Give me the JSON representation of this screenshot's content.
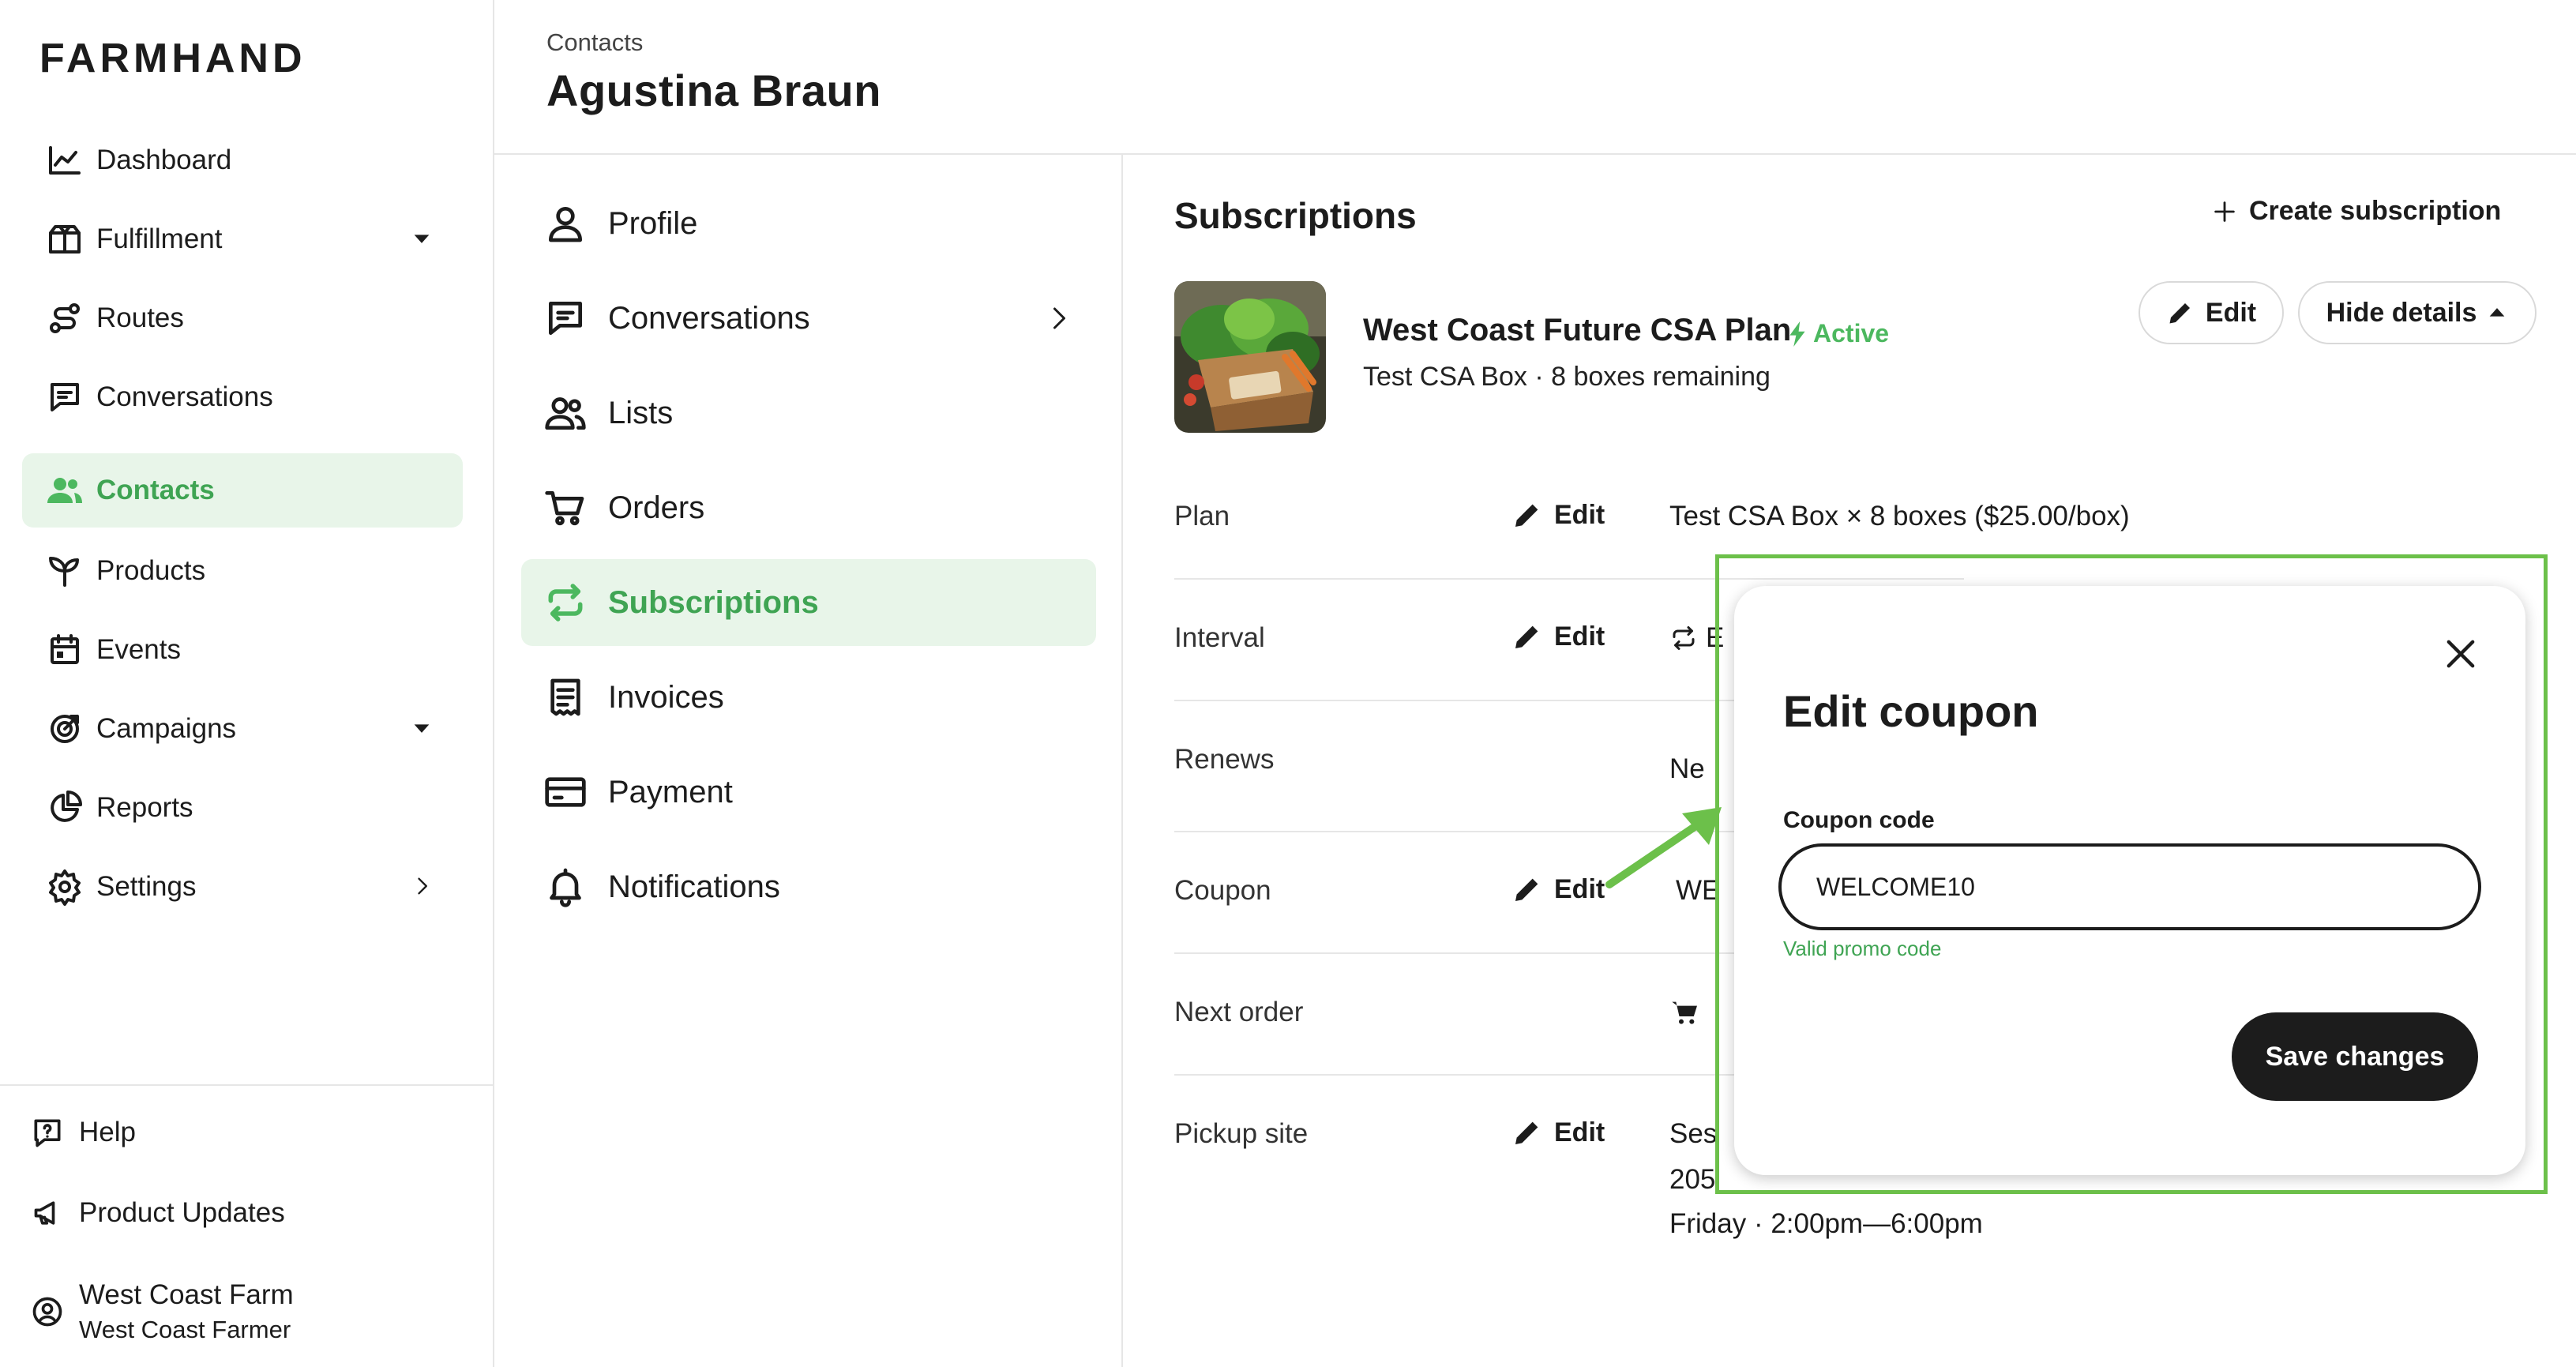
{
  "app": {
    "brand": "FARMHAND"
  },
  "sidebar": {
    "items": [
      {
        "label": "Dashboard",
        "icon": "chart-line-icon"
      },
      {
        "label": "Fulfillment",
        "icon": "box-icon"
      },
      {
        "label": "Routes",
        "icon": "route-icon"
      },
      {
        "label": "Conversations",
        "icon": "chat-icon"
      },
      {
        "label": "Contacts",
        "icon": "users-icon",
        "active": true
      },
      {
        "label": "Products",
        "icon": "sprout-icon"
      },
      {
        "label": "Events",
        "icon": "calendar-icon"
      },
      {
        "label": "Campaigns",
        "icon": "target-icon"
      },
      {
        "label": "Reports",
        "icon": "pie-chart-icon"
      },
      {
        "label": "Settings",
        "icon": "gear-icon"
      }
    ],
    "footer": {
      "help": "Help",
      "product_updates": "Product Updates",
      "account_name": "West Coast Farm",
      "account_role": "West Coast Farmer"
    }
  },
  "header": {
    "breadcrumb": "Contacts",
    "title": "Agustina Braun"
  },
  "subnav": {
    "items": [
      {
        "label": "Profile",
        "icon": "user-icon"
      },
      {
        "label": "Conversations",
        "icon": "chat-icon"
      },
      {
        "label": "Lists",
        "icon": "users-icon"
      },
      {
        "label": "Orders",
        "icon": "cart-icon"
      },
      {
        "label": "Subscriptions",
        "icon": "repeat-icon",
        "active": true
      },
      {
        "label": "Invoices",
        "icon": "receipt-icon"
      },
      {
        "label": "Payment",
        "icon": "credit-card-icon"
      },
      {
        "label": "Notifications",
        "icon": "bell-icon"
      }
    ]
  },
  "subscriptions": {
    "section_title": "Subscriptions",
    "create_label": "Create subscription",
    "plan": {
      "name": "West Coast Future CSA Plan",
      "status": "Active",
      "summary": "Test CSA Box · 8 boxes remaining",
      "edit_label": "Edit",
      "hide_details_label": "Hide details"
    },
    "rows": {
      "plan": {
        "label": "Plan",
        "edit": "Edit",
        "value": "Test CSA Box × 8 boxes ($25.00/box)"
      },
      "interval": {
        "label": "Interval",
        "edit": "Edit",
        "value": "E"
      },
      "renews": {
        "label": "Renews",
        "value": "Ne"
      },
      "coupon": {
        "label": "Coupon",
        "edit": "Edit",
        "value": "WE"
      },
      "next_order": {
        "label": "Next order"
      },
      "pickup_site": {
        "label": "Pickup site",
        "edit": "Edit",
        "value_line1": "Ses",
        "value_line2": "205",
        "value_line3": "Friday · 2:00pm—6:00pm"
      }
    }
  },
  "modal": {
    "title": "Edit coupon",
    "field_label": "Coupon code",
    "field_value": "WELCOME10",
    "help_text": "Valid promo code",
    "save_label": "Save changes"
  },
  "colors": {
    "accent": "#4cb85f",
    "active_bg": "#e8f5e9",
    "highlight": "#6cc04a",
    "button_dark": "#1c1c1c"
  }
}
